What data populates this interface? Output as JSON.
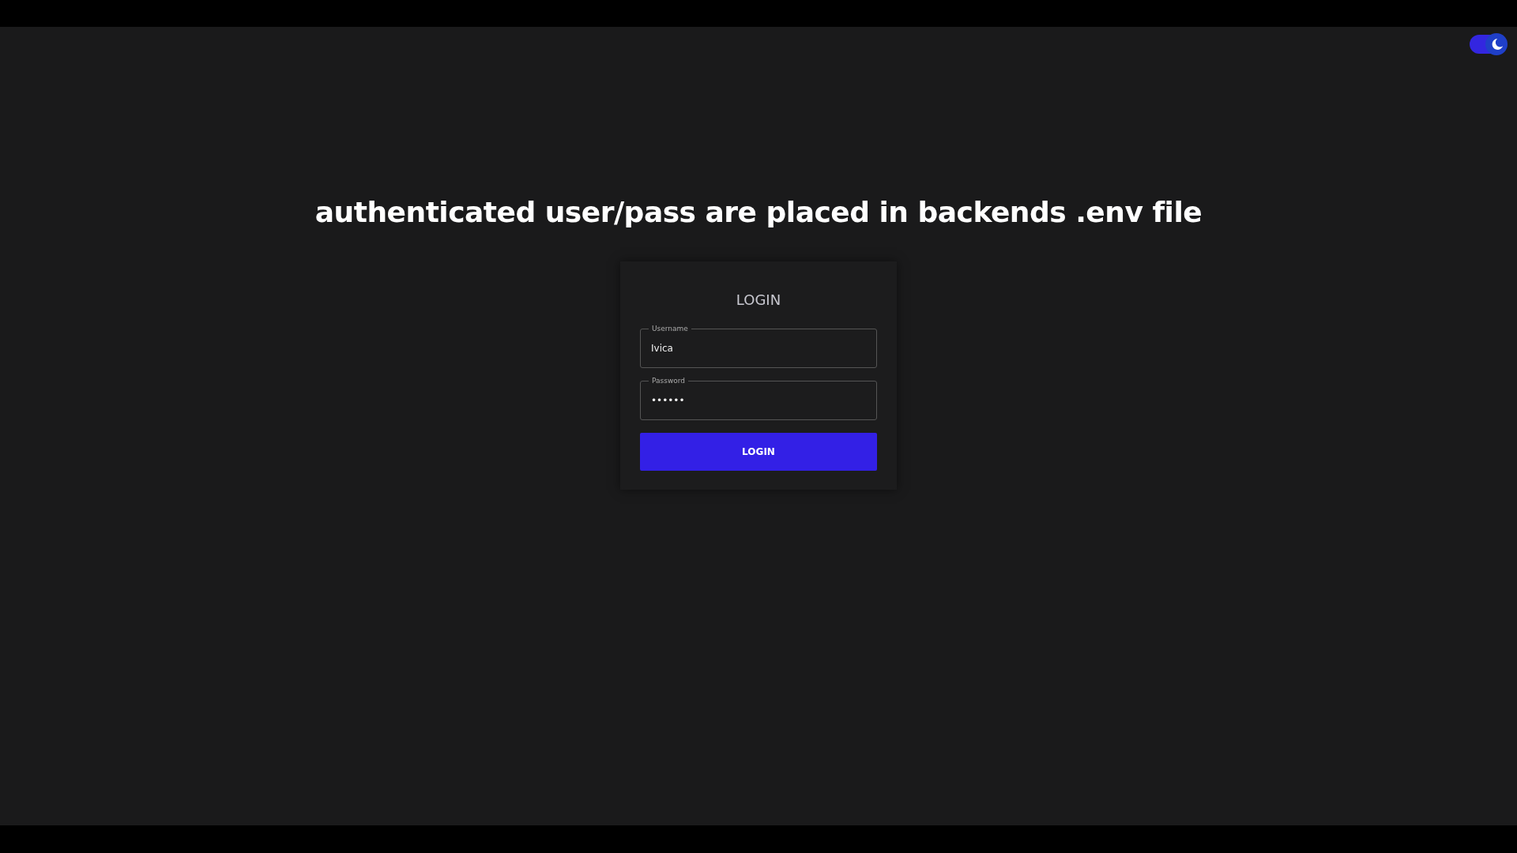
{
  "theme_toggle": {
    "on": true
  },
  "heading": "authenticated user/pass are placed in backends .env file",
  "login_card": {
    "title": "LOGIN",
    "fields": [
      {
        "label": "Username",
        "value": "Ivica"
      },
      {
        "label": "Password",
        "value": "••••••"
      }
    ],
    "button": "LOGIN"
  }
}
